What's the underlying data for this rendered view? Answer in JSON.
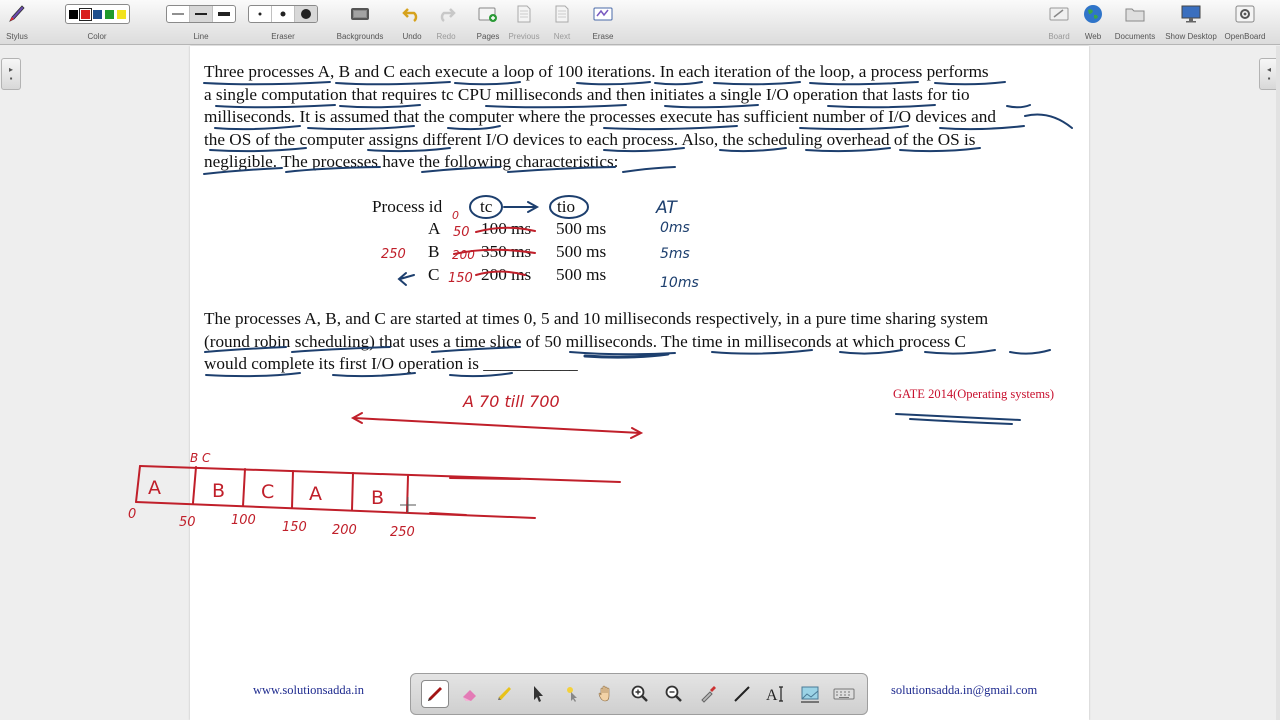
{
  "toolbar": {
    "stylus": "Stylus",
    "color": "Color",
    "line": "Line",
    "eraser": "Eraser",
    "backgrounds": "Backgrounds",
    "undo": "Undo",
    "redo": "Redo",
    "pages": "Pages",
    "previous": "Previous",
    "next": "Next",
    "erase": "Erase",
    "board": "Board",
    "web": "Web",
    "documents": "Documents",
    "show_desktop": "Show Desktop",
    "openboard": "OpenBoard"
  },
  "palette_colors": [
    "#000000",
    "#d91c1c",
    "#1b4e8c",
    "#1f9a2a",
    "#f2e21c"
  ],
  "question": {
    "p1": [
      "Three processes A, B and C each execute a loop of 100 iterations. In each iteration of the loop, a process performs",
      "a single computation that requires tc CPU milliseconds and then initiates a single I/O operation that lasts for tio",
      "milliseconds. It is assumed that the computer where the processes execute has sufficient number of I/O devices and",
      "the OS of the computer assigns different I/O devices to each process. Also, the scheduling overhead of the OS is",
      "negligible. The processes have the following characteristics:"
    ],
    "table": {
      "header": [
        "Process id",
        "tc",
        "tio"
      ],
      "rows": [
        [
          "A",
          "100 ms",
          "500 ms"
        ],
        [
          "B",
          "350 ms",
          "500 ms"
        ],
        [
          "C",
          "200 ms",
          "500 ms"
        ]
      ]
    },
    "p2": [
      "The processes A, B, and C are started at times 0, 5 and 10 milliseconds respectively, in a pure time sharing system",
      "(round robin scheduling) that uses a time slice of 50 milliseconds. The time in milliseconds at which process C",
      "would complete its first I/O operation is ___________"
    ],
    "source": "GATE 2014(Operating systems)"
  },
  "annotations": {
    "arrival_header": "AT",
    "arrivals": [
      "0ms",
      "5ms",
      "10ms"
    ],
    "remaining": [
      "50",
      "200",
      "150"
    ],
    "b_marker": "250",
    "zero_marker": "0",
    "note": "A 70 till 700",
    "gantt_top": "B C",
    "gantt_cells": [
      "A",
      "B",
      "C",
      "A",
      "B"
    ],
    "gantt_ticks": [
      "0",
      "50",
      "100",
      "150",
      "200",
      "250"
    ]
  },
  "footer": {
    "website": "www.solutionsadda.in",
    "email": "solutionsadda.in@gmail.com"
  },
  "dock_tools": [
    "pen-icon",
    "marker-eraser-icon",
    "highlighter-icon",
    "pointer-icon",
    "laser-icon",
    "hand-icon",
    "zoom-in-icon",
    "zoom-out-icon",
    "pipette-icon",
    "line-icon",
    "text-icon",
    "capture-icon",
    "keyboard-icon"
  ],
  "side_tabs": {
    "left": "▸",
    "right": "◂"
  }
}
